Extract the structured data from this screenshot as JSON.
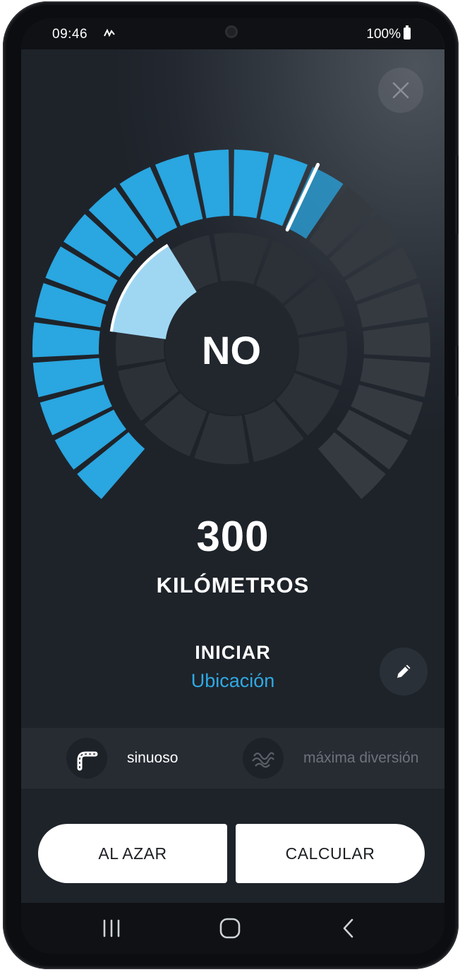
{
  "status_bar": {
    "time": "09:46",
    "battery": "100%"
  },
  "gauge": {
    "center_label": "NO",
    "outer_fill_fraction": 0.59,
    "inner_fill_fraction": 0.14,
    "accent_color": "#2aa6e0",
    "inactive_color": "#353a41"
  },
  "distance": {
    "value": "300",
    "unit": "KILÓMETROS"
  },
  "start": {
    "label": "INICIAR",
    "value": "Ubicación"
  },
  "route_options": [
    {
      "label": "sinuoso",
      "icon": "winding-road-icon",
      "active": true
    },
    {
      "label": "máxima diversión",
      "icon": "fun-curves-icon",
      "active": false
    }
  ],
  "actions": {
    "random_label": "AL AZAR",
    "calculate_label": "CALCULAR"
  },
  "colors": {
    "accent": "#2fa9e3",
    "background": "#1e232a"
  }
}
